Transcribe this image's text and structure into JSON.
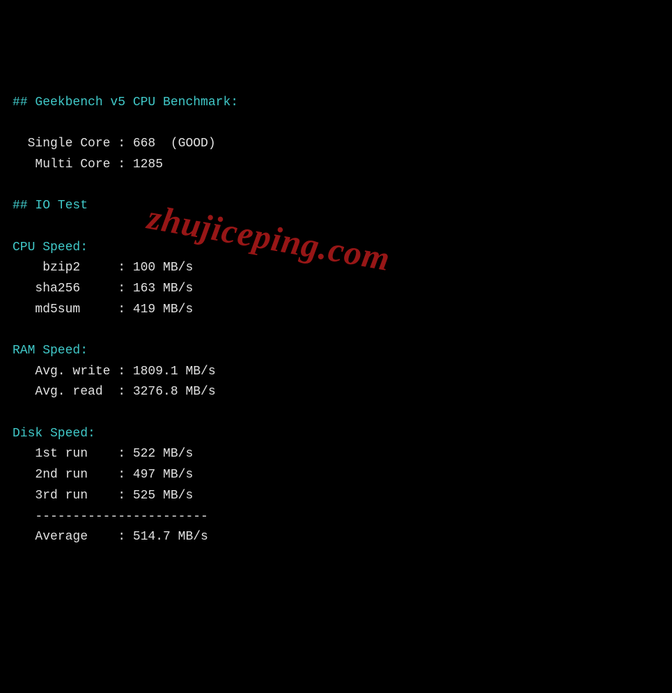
{
  "geekbench": {
    "heading": "## Geekbench v5 CPU Benchmark:",
    "single_core_label": "  Single Core : ",
    "single_core_value": "668  (GOOD)",
    "multi_core_label": "   Multi Core : ",
    "multi_core_value": "1285"
  },
  "io_test": {
    "heading": "## IO Test"
  },
  "cpu_speed": {
    "heading": "CPU Speed:",
    "bzip2_label": "    bzip2     : ",
    "bzip2_value": "100 MB/s",
    "sha256_label": "   sha256     : ",
    "sha256_value": "163 MB/s",
    "md5sum_label": "   md5sum     : ",
    "md5sum_value": "419 MB/s"
  },
  "ram_speed": {
    "heading": "RAM Speed:",
    "write_label": "   Avg. write : ",
    "write_value": "1809.1 MB/s",
    "read_label": "   Avg. read  : ",
    "read_value": "3276.8 MB/s"
  },
  "disk_speed": {
    "heading": "Disk Speed:",
    "run1_label": "   1st run    : ",
    "run1_value": "522 MB/s",
    "run2_label": "   2nd run    : ",
    "run2_value": "497 MB/s",
    "run3_label": "   3rd run    : ",
    "run3_value": "525 MB/s",
    "divider": "   -----------------------",
    "avg_label": "   Average    : ",
    "avg_value": "514.7 MB/s"
  },
  "watermark": "zhujiceping.com"
}
